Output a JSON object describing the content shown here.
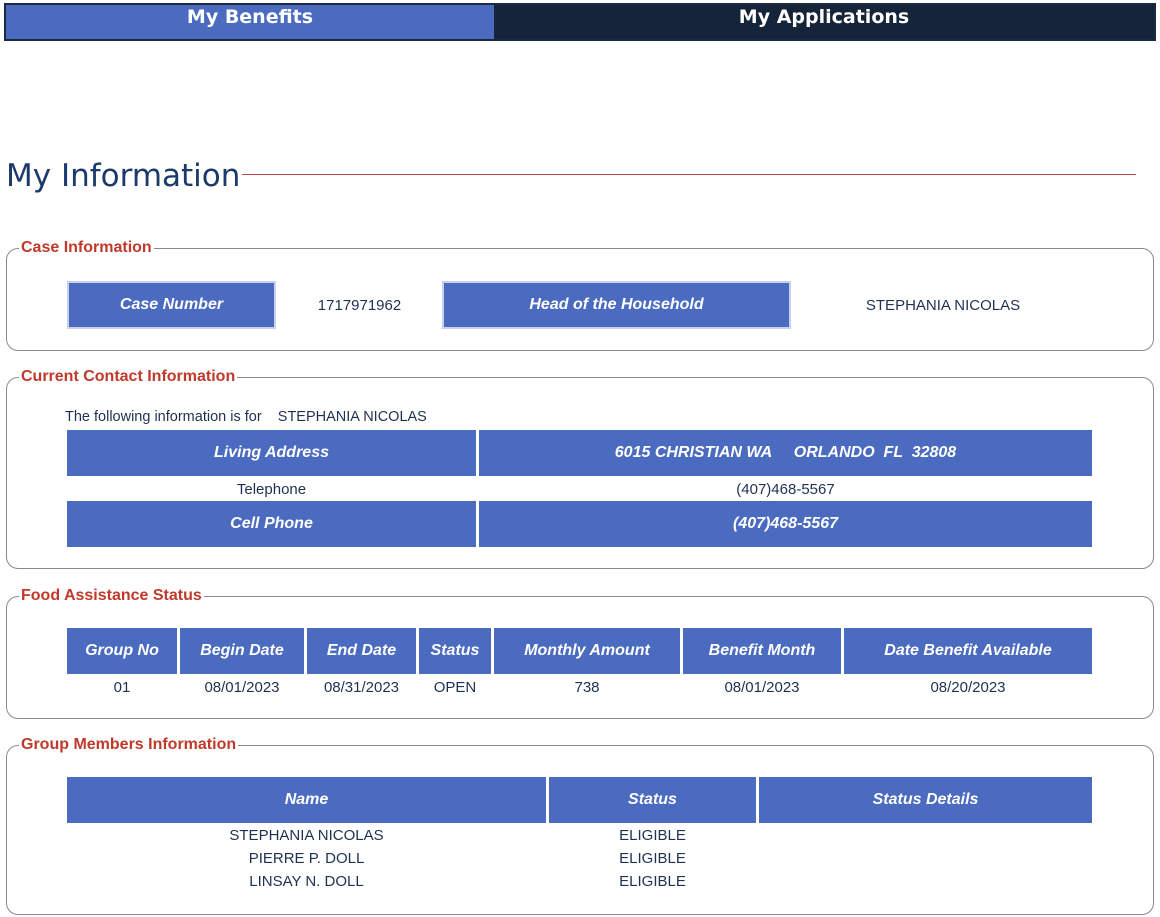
{
  "tabs": {
    "benefits": "My Benefits",
    "applications": "My Applications"
  },
  "page_title": "My Information",
  "case_information": {
    "legend": "Case Information",
    "case_number_label": "Case Number",
    "case_number_value": "1717971962",
    "head_label": "Head of the Household",
    "head_value": "STEPHANIA NICOLAS"
  },
  "contact_information": {
    "legend": "Current Contact Information",
    "intro_label": "The following information is for",
    "intro_name": "STEPHANIA NICOLAS",
    "living_address_label": "Living Address",
    "living_address_value": "6015 CHRISTIAN WA     ORLANDO  FL  32808",
    "telephone_label": "Telephone",
    "telephone_value": "(407)468-5567",
    "cell_phone_label": "Cell Phone",
    "cell_phone_value": "(407)468-5567"
  },
  "food_assistance": {
    "legend": "Food Assistance Status",
    "headers": [
      "Group No",
      "Begin Date",
      "End Date",
      "Status",
      "Monthly Amount",
      "Benefit Month",
      "Date Benefit Available"
    ],
    "row": [
      "01",
      "08/01/2023",
      "08/31/2023",
      "OPEN",
      "738",
      "08/01/2023",
      "08/20/2023"
    ]
  },
  "group_members": {
    "legend": "Group Members Information",
    "headers": [
      "Name",
      "Status",
      "Status Details"
    ],
    "rows": [
      {
        "name": "STEPHANIA NICOLAS",
        "status": "ELIGIBLE",
        "details": ""
      },
      {
        "name": "PIERRE P. DOLL",
        "status": "ELIGIBLE",
        "details": ""
      },
      {
        "name": "LINSAY N. DOLL",
        "status": "ELIGIBLE",
        "details": ""
      }
    ]
  },
  "colors": {
    "header_fill": "#4b6bc0",
    "nav_dark": "#16243a",
    "legend_red": "#c0392b",
    "text_navy": "#1f3150"
  }
}
